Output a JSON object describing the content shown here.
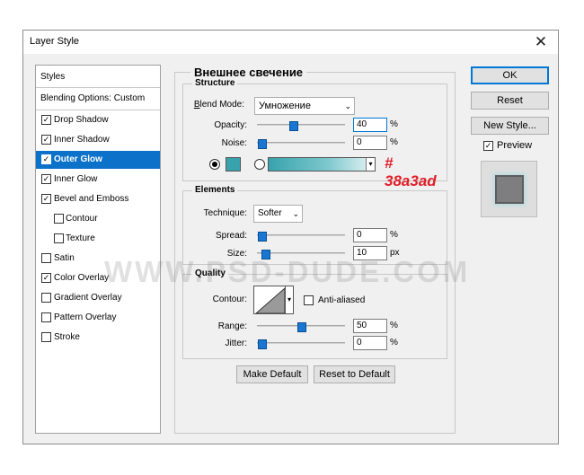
{
  "window": {
    "title": "Layer Style",
    "close_glyph": "✕"
  },
  "styles_panel": {
    "header": "Styles",
    "blending": "Blending Options: Custom",
    "items": [
      {
        "label": "Drop Shadow",
        "checked": true,
        "indent": false
      },
      {
        "label": "Inner Shadow",
        "checked": true,
        "indent": false
      },
      {
        "label": "Outer Glow",
        "checked": true,
        "indent": false,
        "active": true
      },
      {
        "label": "Inner Glow",
        "checked": true,
        "indent": false
      },
      {
        "label": "Bevel and Emboss",
        "checked": true,
        "indent": false
      },
      {
        "label": "Contour",
        "checked": false,
        "indent": true
      },
      {
        "label": "Texture",
        "checked": false,
        "indent": true
      },
      {
        "label": "Satin",
        "checked": false,
        "indent": false
      },
      {
        "label": "Color Overlay",
        "checked": true,
        "indent": false
      },
      {
        "label": "Gradient Overlay",
        "checked": false,
        "indent": false
      },
      {
        "label": "Pattern Overlay",
        "checked": false,
        "indent": false
      },
      {
        "label": "Stroke",
        "checked": false,
        "indent": false
      }
    ]
  },
  "main": {
    "title": "Внешнее свечение",
    "structure": {
      "title": "Structure",
      "blend_mode_label": "Blend Mode:",
      "blend_mode_value": "Умножение",
      "opacity_label": "Opacity:",
      "opacity_value": "40",
      "opacity_pct": 40,
      "noise_label": "Noise:",
      "noise_value": "0",
      "noise_pct": 0,
      "percent": "%",
      "glow_color": "#38a3ad",
      "color_note": "# 38a3ad"
    },
    "elements": {
      "title": "Elements",
      "technique_label": "Technique:",
      "technique_value": "Softer",
      "spread_label": "Spread:",
      "spread_value": "0",
      "spread_pct": 0,
      "size_label": "Size:",
      "size_value": "10",
      "size_pct": 4,
      "percent": "%",
      "px": "px"
    },
    "quality": {
      "title": "Quality",
      "contour_label": "Contour:",
      "anti_aliased_label": "Anti-aliased",
      "range_label": "Range:",
      "range_value": "50",
      "range_pct": 50,
      "jitter_label": "Jitter:",
      "jitter_value": "0",
      "jitter_pct": 0,
      "percent": "%"
    },
    "make_default": "Make Default",
    "reset_to_default": "Reset to Default"
  },
  "buttons": {
    "ok": "OK",
    "reset": "Reset",
    "new_style": "New Style...",
    "preview_label": "Preview"
  },
  "watermark": "WWW.PSD-DUDE.COM"
}
